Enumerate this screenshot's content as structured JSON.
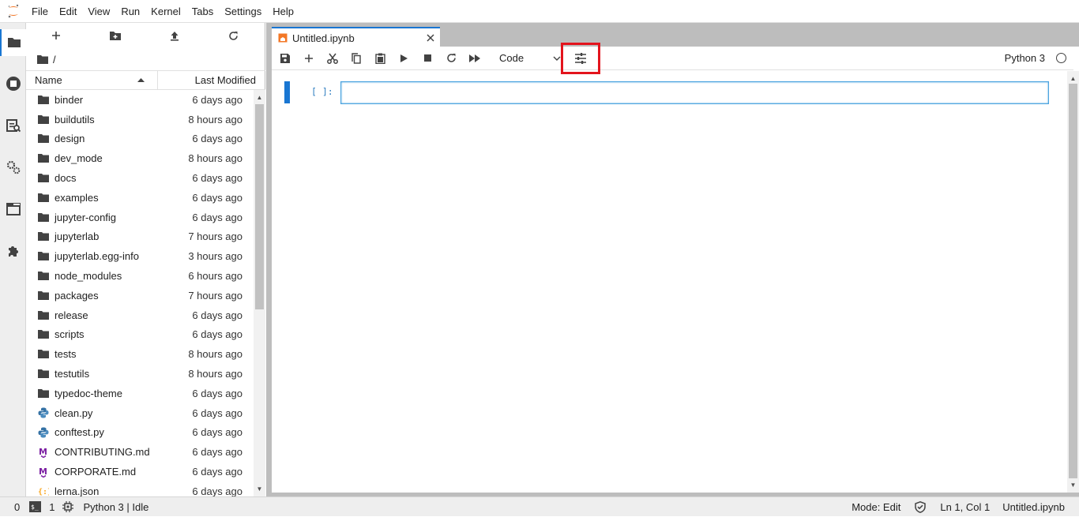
{
  "menu": [
    "File",
    "Edit",
    "View",
    "Run",
    "Kernel",
    "Tabs",
    "Settings",
    "Help"
  ],
  "breadcrumb": "/",
  "file_browser": {
    "col_name": "Name",
    "col_modified": "Last Modified",
    "files": [
      {
        "name": "binder",
        "modified": "6 days ago",
        "type": "folder"
      },
      {
        "name": "buildutils",
        "modified": "8 hours ago",
        "type": "folder"
      },
      {
        "name": "design",
        "modified": "6 days ago",
        "type": "folder"
      },
      {
        "name": "dev_mode",
        "modified": "8 hours ago",
        "type": "folder"
      },
      {
        "name": "docs",
        "modified": "6 days ago",
        "type": "folder"
      },
      {
        "name": "examples",
        "modified": "6 days ago",
        "type": "folder"
      },
      {
        "name": "jupyter-config",
        "modified": "6 days ago",
        "type": "folder"
      },
      {
        "name": "jupyterlab",
        "modified": "7 hours ago",
        "type": "folder"
      },
      {
        "name": "jupyterlab.egg-info",
        "modified": "3 hours ago",
        "type": "folder"
      },
      {
        "name": "node_modules",
        "modified": "6 hours ago",
        "type": "folder"
      },
      {
        "name": "packages",
        "modified": "7 hours ago",
        "type": "folder"
      },
      {
        "name": "release",
        "modified": "6 days ago",
        "type": "folder"
      },
      {
        "name": "scripts",
        "modified": "6 days ago",
        "type": "folder"
      },
      {
        "name": "tests",
        "modified": "8 hours ago",
        "type": "folder"
      },
      {
        "name": "testutils",
        "modified": "8 hours ago",
        "type": "folder"
      },
      {
        "name": "typedoc-theme",
        "modified": "6 days ago",
        "type": "folder"
      },
      {
        "name": "clean.py",
        "modified": "6 days ago",
        "type": "python"
      },
      {
        "name": "conftest.py",
        "modified": "6 days ago",
        "type": "python"
      },
      {
        "name": "CONTRIBUTING.md",
        "modified": "6 days ago",
        "type": "markdown"
      },
      {
        "name": "CORPORATE.md",
        "modified": "6 days ago",
        "type": "markdown"
      },
      {
        "name": "lerna.json",
        "modified": "6 days ago",
        "type": "json"
      }
    ]
  },
  "tab": {
    "title": "Untitled.ipynb"
  },
  "notebook": {
    "cell_type": "Code",
    "kernel": "Python 3",
    "prompt": "[ ]:"
  },
  "status": {
    "terminals": "0",
    "kernels": "1",
    "kernel_status": "Python 3 | Idle",
    "mode": "Mode: Edit",
    "cursor": "Ln 1, Col 1",
    "filename": "Untitled.ipynb"
  },
  "colors": {
    "accent": "#1976d2",
    "highlight": "#e3141d",
    "jupyter_orange": "#f37726"
  }
}
